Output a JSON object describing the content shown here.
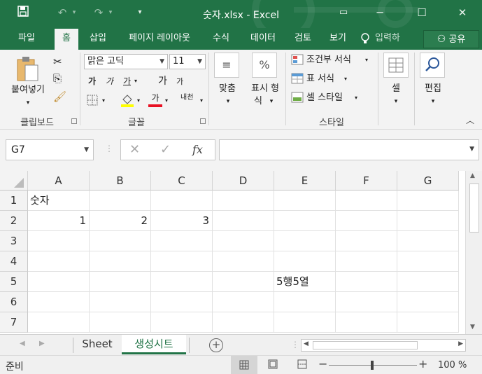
{
  "window": {
    "title": "숫자.xlsx - Excel",
    "minimize_glyph": "─",
    "restore_glyph": "☐",
    "close_glyph": "✕"
  },
  "quick_access": {
    "save_icon": "save-icon",
    "undo_icon": "undo-icon",
    "redo_icon": "redo-icon",
    "customize_icon": "customize-icon"
  },
  "tabs": {
    "file": "파일",
    "home": "홈",
    "insert": "삽입",
    "page_layout": "페이지 레이아웃",
    "formulas": "수식",
    "data": "데이터",
    "review": "검토",
    "view": "보기",
    "tell_me": "입력하",
    "share": "공유"
  },
  "ribbon": {
    "clipboard": {
      "paste_label": "붙여넣기",
      "group_label": "클립보드"
    },
    "font": {
      "font_name": "맑은 고딕",
      "font_size": "11",
      "bold": "가",
      "italic": "가",
      "underline": "가",
      "grow": "가",
      "shrink": "가",
      "font_color": "가",
      "phonetic": "내천",
      "group_label": "글꼴"
    },
    "alignment": {
      "label": "맞춤"
    },
    "number": {
      "label_line1": "표시 형",
      "label_line2": "식",
      "icon_text": "%"
    },
    "styles": {
      "conditional": "조건부 서식",
      "table": "표 서식",
      "cell_styles": "셀 스타일",
      "group_label": "스타일"
    },
    "cells": {
      "label": "셀"
    },
    "editing": {
      "label": "편집"
    }
  },
  "formula_bar": {
    "name_box": "G7",
    "formula": "",
    "fx": "fx"
  },
  "grid": {
    "columns": [
      "A",
      "B",
      "C",
      "D",
      "E",
      "F",
      "G"
    ],
    "rows": [
      "1",
      "2",
      "3",
      "4",
      "5",
      "6",
      "7"
    ],
    "cells": {
      "A1": "숫자",
      "A2": "1",
      "B2": "2",
      "C2": "3",
      "E5": "5행5열"
    }
  },
  "sheets": [
    "Sheet",
    "생성시트"
  ],
  "status": {
    "ready": "준비",
    "zoom": "100 %"
  },
  "colors": {
    "accent": "#217346",
    "font_color_bar": "#e81123",
    "highlight_bar": "#ffff00"
  }
}
